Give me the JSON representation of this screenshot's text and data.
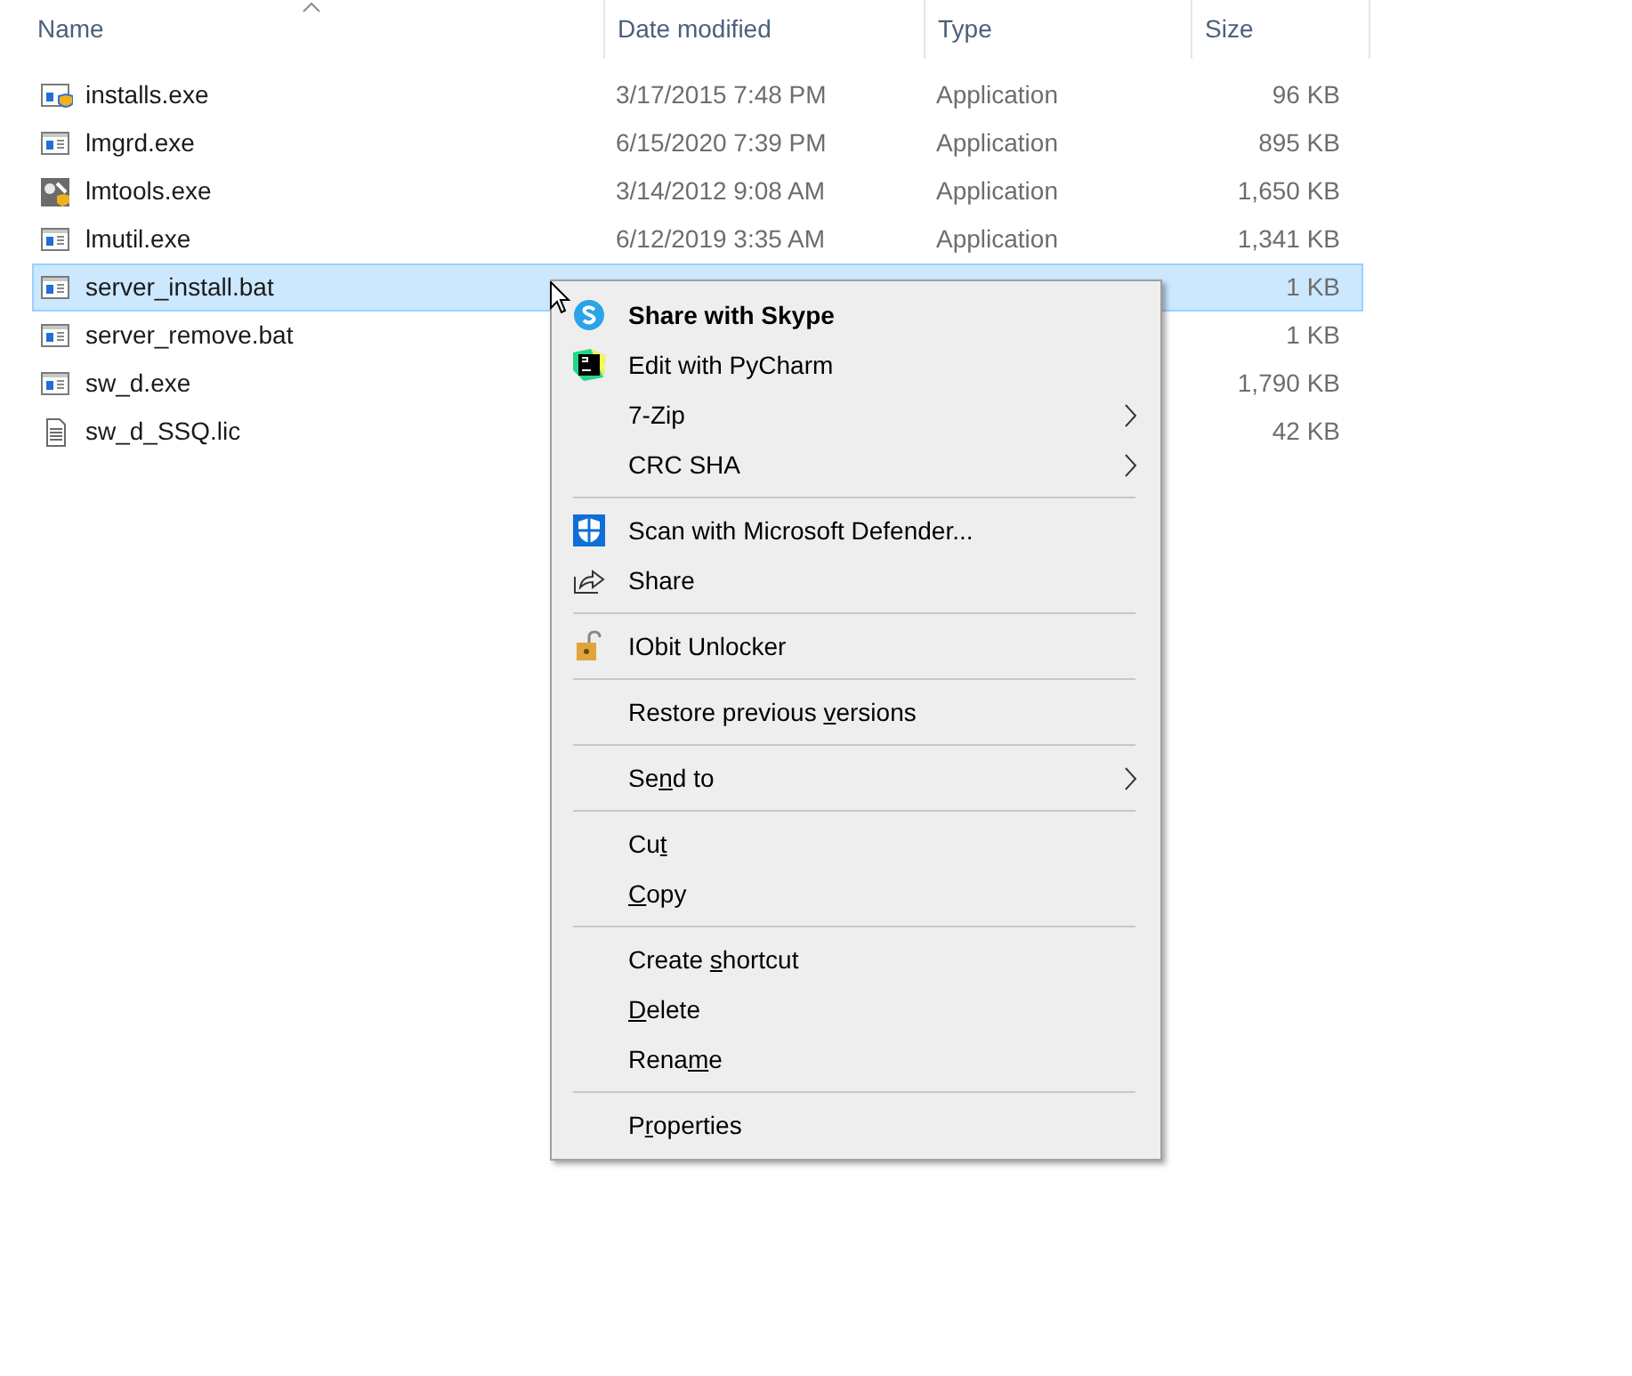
{
  "file_list": {
    "columns": [
      {
        "label": "Name",
        "sort_indicator": true
      },
      {
        "label": "Date modified",
        "sort_indicator": false
      },
      {
        "label": "Type",
        "sort_indicator": false
      },
      {
        "label": "Size",
        "sort_indicator": false
      }
    ],
    "rows": [
      {
        "name": "installs.exe",
        "kind": "shield-app",
        "date": "3/17/2015 7:48 PM",
        "type": "Application",
        "size": "96 KB",
        "selected": false
      },
      {
        "name": "lmgrd.exe",
        "kind": "app",
        "date": "6/15/2020 7:39 PM",
        "type": "Application",
        "size": "895 KB",
        "selected": false
      },
      {
        "name": "lmtools.exe",
        "kind": "tools-app",
        "date": "3/14/2012 9:08 AM",
        "type": "Application",
        "size": "1,650 KB",
        "selected": false
      },
      {
        "name": "lmutil.exe",
        "kind": "app",
        "date": "6/12/2019 3:35 AM",
        "type": "Application",
        "size": "1,341 KB",
        "selected": false
      },
      {
        "name": "server_install.bat",
        "kind": "app",
        "size": "1 KB",
        "selected": true
      },
      {
        "name": "server_remove.bat",
        "kind": "app",
        "size": "1 KB",
        "selected": false
      },
      {
        "name": "sw_d.exe",
        "kind": "app",
        "size": "1,790 KB",
        "selected": false
      },
      {
        "name": "sw_d_SSQ.lic",
        "kind": "document",
        "size": "42 KB",
        "selected": false
      }
    ]
  },
  "context_menu": {
    "groups": [
      [
        {
          "label_before": "Share with Skype",
          "kind": "skype",
          "bold": true,
          "submenu": false
        },
        {
          "label_before": "Edit with PyCharm",
          "kind": "pycharm",
          "bold": false,
          "submenu": false
        },
        {
          "label_before": "7-Zip",
          "kind": "plain",
          "bold": false,
          "submenu": true
        },
        {
          "label_before": "CRC SHA",
          "kind": "plain",
          "bold": false,
          "submenu": true
        }
      ],
      [
        {
          "label_before": "Scan with Microsoft Defender...",
          "kind": "defender",
          "bold": false,
          "submenu": false
        },
        {
          "label_before": "Share",
          "kind": "share",
          "bold": false,
          "submenu": false
        }
      ],
      [
        {
          "label_before": "IObit Unlocker",
          "kind": "unlocker",
          "bold": false,
          "submenu": false
        }
      ],
      [
        {
          "label_before": "Restore previous ",
          "access_key": "v",
          "label_after": "ersions",
          "kind": "plain",
          "bold": false,
          "submenu": false
        }
      ],
      [
        {
          "label_before": "Se",
          "access_key": "n",
          "label_after": "d to",
          "kind": "plain",
          "bold": false,
          "submenu": true
        }
      ],
      [
        {
          "label_before": "Cu",
          "access_key": "t",
          "kind": "plain",
          "bold": false,
          "submenu": false
        },
        {
          "access_key": "C",
          "label_after": "opy",
          "kind": "plain",
          "bold": false,
          "submenu": false
        }
      ],
      [
        {
          "label_before": "Create ",
          "access_key": "s",
          "label_after": "hortcut",
          "kind": "plain",
          "bold": false,
          "submenu": false
        },
        {
          "access_key": "D",
          "label_after": "elete",
          "kind": "plain",
          "bold": false,
          "submenu": false
        },
        {
          "label_before": "Rena",
          "access_key": "m",
          "label_after": "e",
          "kind": "plain",
          "bold": false,
          "submenu": false
        }
      ],
      [
        {
          "label_before": "P",
          "access_key": "r",
          "label_after": "operties",
          "kind": "plain",
          "bold": false,
          "submenu": false
        }
      ]
    ]
  }
}
